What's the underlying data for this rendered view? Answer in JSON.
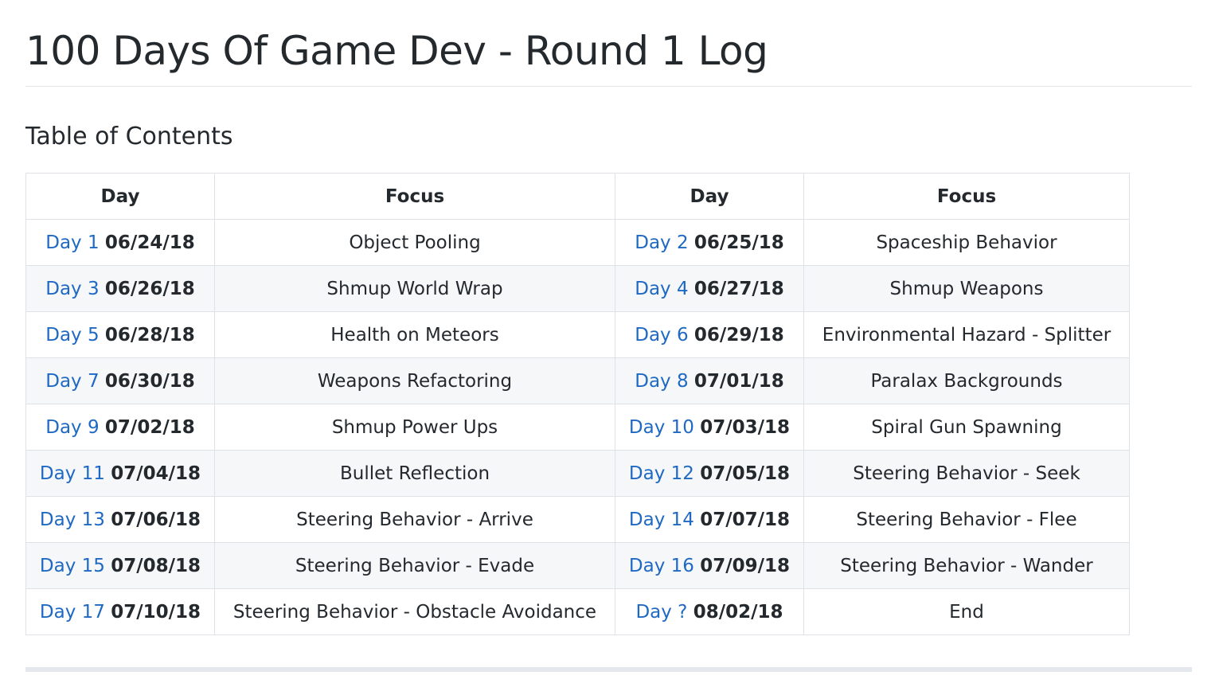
{
  "page": {
    "title": "100 Days Of Game Dev - Round 1 Log",
    "toc_heading": "Table of Contents"
  },
  "table": {
    "headers": [
      "Day",
      "Focus",
      "Day",
      "Focus"
    ],
    "rows": [
      {
        "left": {
          "day": "Day 1",
          "date": "06/24/18",
          "focus": "Object Pooling"
        },
        "right": {
          "day": "Day 2",
          "date": "06/25/18",
          "focus": "Spaceship Behavior"
        }
      },
      {
        "left": {
          "day": "Day 3",
          "date": "06/26/18",
          "focus": "Shmup World Wrap"
        },
        "right": {
          "day": "Day 4",
          "date": "06/27/18",
          "focus": "Shmup Weapons"
        }
      },
      {
        "left": {
          "day": "Day 5",
          "date": "06/28/18",
          "focus": "Health on Meteors"
        },
        "right": {
          "day": "Day 6",
          "date": "06/29/18",
          "focus": "Environmental Hazard - Splitter"
        }
      },
      {
        "left": {
          "day": "Day 7",
          "date": "06/30/18",
          "focus": "Weapons Refactoring"
        },
        "right": {
          "day": "Day 8",
          "date": "07/01/18",
          "focus": "Paralax Backgrounds"
        }
      },
      {
        "left": {
          "day": "Day 9",
          "date": "07/02/18",
          "focus": "Shmup Power Ups"
        },
        "right": {
          "day": "Day 10",
          "date": "07/03/18",
          "focus": "Spiral Gun Spawning"
        }
      },
      {
        "left": {
          "day": "Day 11",
          "date": "07/04/18",
          "focus": "Bullet Reflection"
        },
        "right": {
          "day": "Day 12",
          "date": "07/05/18",
          "focus": "Steering Behavior - Seek"
        }
      },
      {
        "left": {
          "day": "Day 13",
          "date": "07/06/18",
          "focus": "Steering Behavior - Arrive"
        },
        "right": {
          "day": "Day 14",
          "date": "07/07/18",
          "focus": "Steering Behavior - Flee"
        }
      },
      {
        "left": {
          "day": "Day 15",
          "date": "07/08/18",
          "focus": "Steering Behavior - Evade"
        },
        "right": {
          "day": "Day 16",
          "date": "07/09/18",
          "focus": "Steering Behavior - Wander"
        }
      },
      {
        "left": {
          "day": "Day 17",
          "date": "07/10/18",
          "focus": "Steering Behavior - Obstacle Avoidance"
        },
        "right": {
          "day": "Day ?",
          "date": "08/02/18",
          "focus": "End"
        }
      }
    ]
  },
  "colors": {
    "link": "#1f69c3",
    "text": "#24292e",
    "border": "#dee2e6",
    "stripe": "#f5f7f9"
  }
}
